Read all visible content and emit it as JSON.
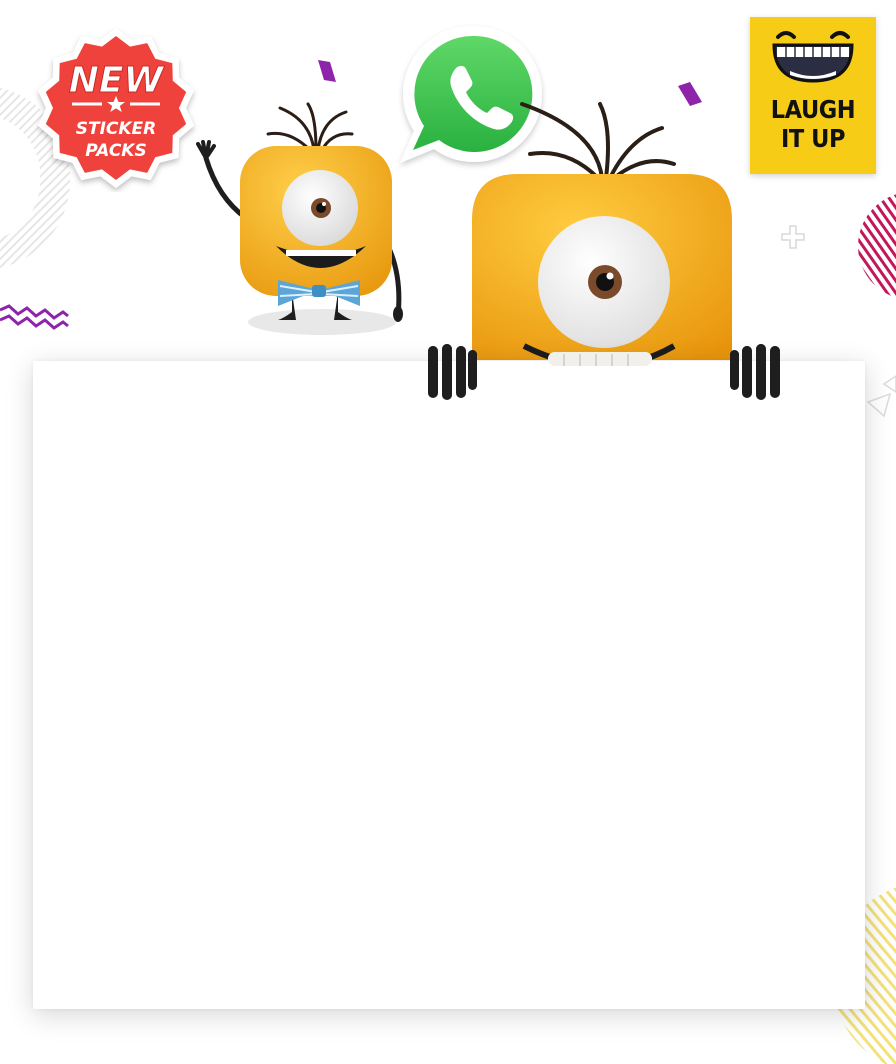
{
  "badge": {
    "line1": "NEW",
    "line2": "STICKER",
    "line3": "PACKS",
    "color": "#f0423c"
  },
  "sticker": {
    "line1": "LAUGH",
    "line2": "IT UP",
    "background": "#f6cc17"
  },
  "colors": {
    "accent_purple": "#8e24aa",
    "accent_magenta": "#c2185b",
    "mascot_yellow": "#f4b51c",
    "whatsapp_green": "#41c44f"
  },
  "icons": [
    "whatsapp-icon",
    "laughing-face-icon",
    "star-icon"
  ]
}
